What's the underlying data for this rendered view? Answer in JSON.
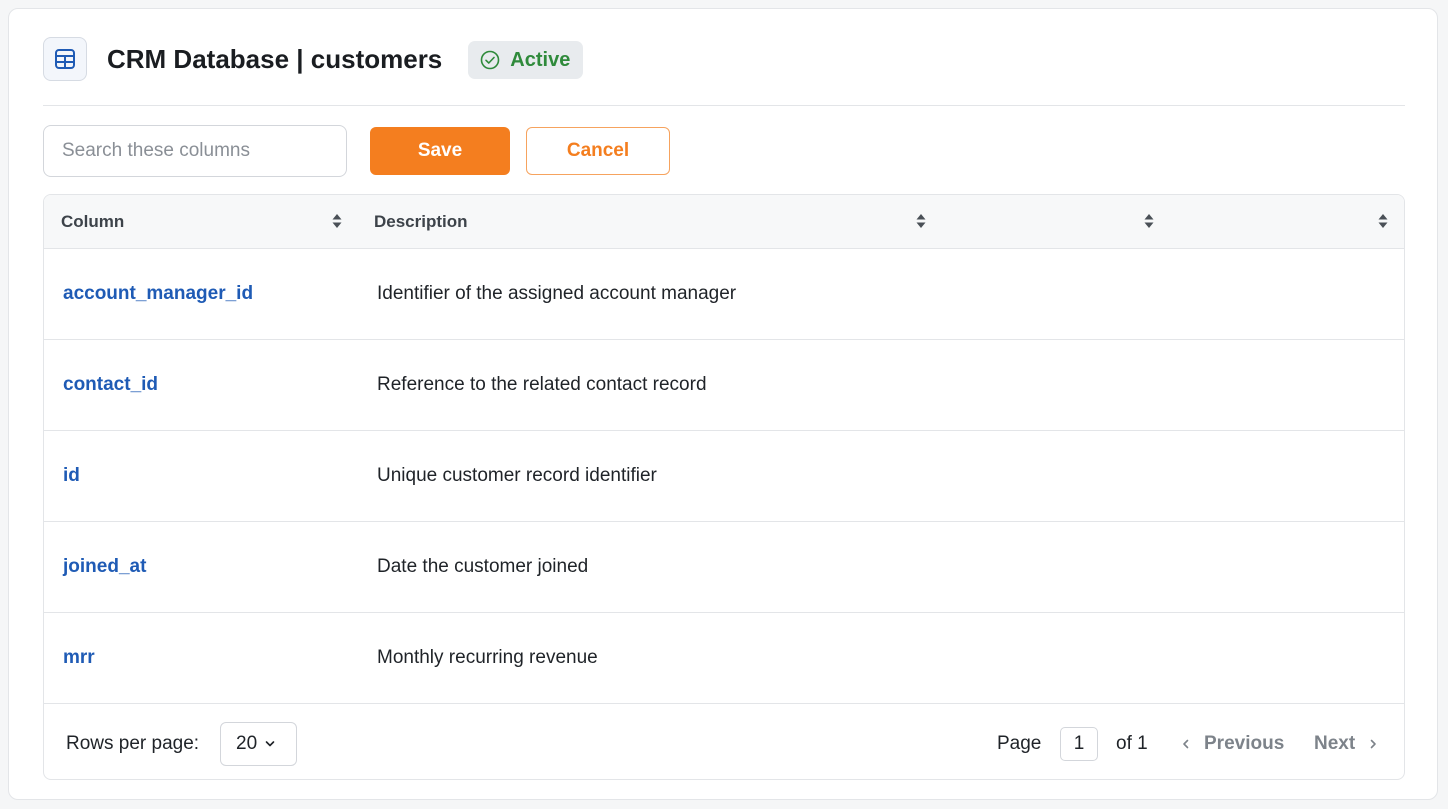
{
  "header": {
    "title": "CRM Database | customers",
    "status_badge": "Active",
    "status_color": "#2f8a3b",
    "icon": "database-table-icon"
  },
  "toolbar": {
    "search_placeholder": "Search these columns",
    "search_value": "",
    "save_label": "Save",
    "cancel_label": "Cancel",
    "accent_color": "#f47e1f"
  },
  "table": {
    "headers": [
      "Column",
      "Description",
      "",
      ""
    ],
    "rows": [
      {
        "column": "account_manager_id",
        "description": "Identifier of the assigned account manager"
      },
      {
        "column": "contact_id",
        "description": "Reference to the related contact record"
      },
      {
        "column": "id",
        "description": "Unique customer record identifier"
      },
      {
        "column": "joined_at",
        "description": "Date the customer joined"
      },
      {
        "column": "mrr",
        "description": "Monthly recurring revenue"
      }
    ]
  },
  "footer": {
    "rows_per_page_label": "Rows per page:",
    "rows_per_page_value": "20",
    "page_label": "Page",
    "current_page": "1",
    "of_label": "of 1",
    "previous_label": "Previous",
    "next_label": "Next"
  }
}
